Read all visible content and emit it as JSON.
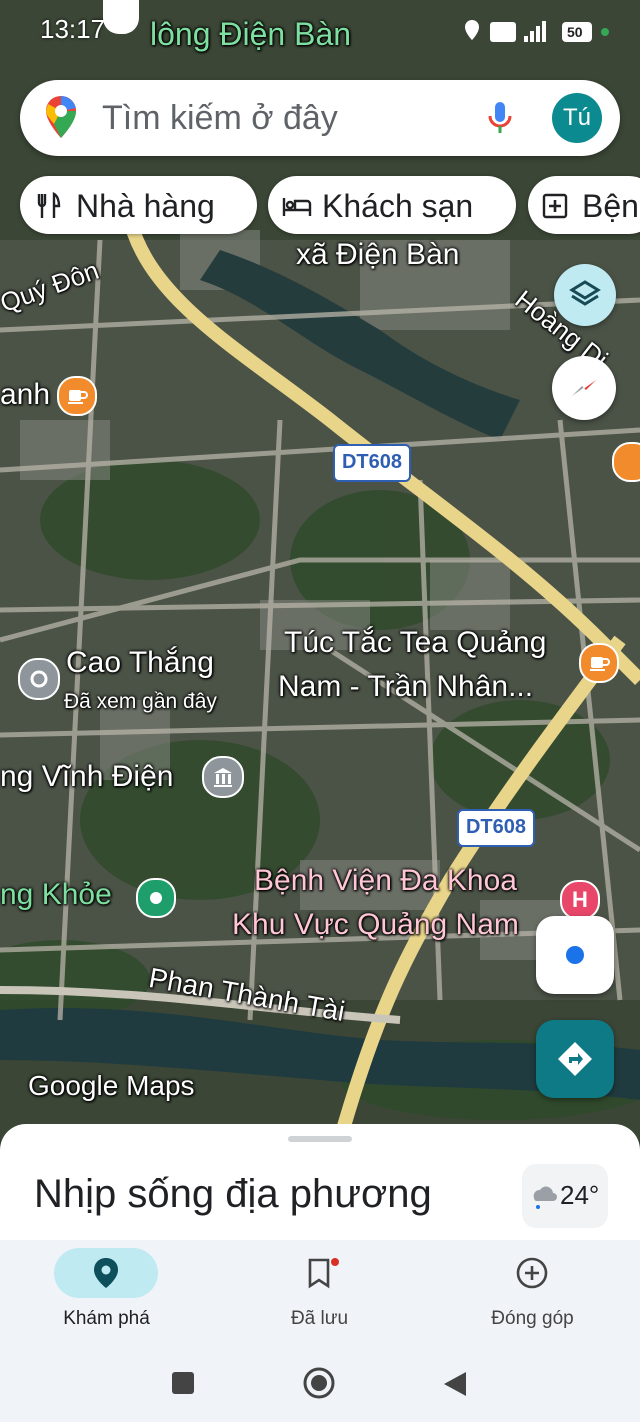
{
  "status_bar": {
    "time": "13:17",
    "battery": "50"
  },
  "search": {
    "placeholder": "Tìm kiếm ở đây",
    "avatar_initials": "Tú"
  },
  "chips": [
    {
      "label": "Nhà hàng",
      "icon": "fork-knife-icon"
    },
    {
      "label": "Khách sạn",
      "icon": "bed-icon"
    },
    {
      "label": "Bện",
      "icon": "hospital-icon"
    }
  ],
  "map": {
    "labels": {
      "top_place": "lông Điện Bàn",
      "commune": "xã Điện Bàn",
      "road_quy_don": "Quý Đôn",
      "road_hoang_dieu": "Hoàng Di",
      "cafe_left": "anh",
      "shield_1": "DT608",
      "shield_2": "DT608",
      "tea_shop_line1": "Túc Tắc Tea Quảng",
      "tea_shop_line2": "Nam - Trần Nhân...",
      "cao_thang": "Cao Thắng",
      "cao_thang_sub": "Đã xem gần đây",
      "vinh_dien": "ng Vĩnh Điện",
      "health": "ng Khỏe",
      "hospital_line1": "Bệnh Viện Đa Khoa",
      "hospital_line2": "Khu Vực Quảng Nam",
      "street": "Phan Thành Tài",
      "google_maps": "Google Maps"
    }
  },
  "sheet": {
    "title": "Nhịp sống địa phương",
    "temperature": "24°"
  },
  "nav": [
    {
      "label": "Khám phá",
      "icon": "explore-pin-icon",
      "active": true
    },
    {
      "label": "Đã lưu",
      "icon": "bookmark-icon",
      "active": false
    },
    {
      "label": "Đóng góp",
      "icon": "add-circle-icon",
      "active": false
    }
  ],
  "colors": {
    "accent": "#0b8a8f",
    "directions": "#0e7a86",
    "compass_red": "#e53935",
    "location_blue": "#1a73e8"
  }
}
